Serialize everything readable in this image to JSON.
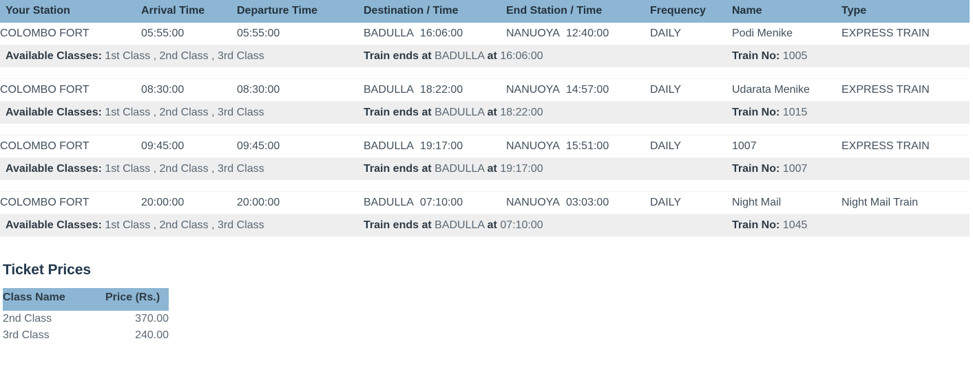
{
  "table": {
    "columns": [
      "Your Station",
      "Arrival Time",
      "Departure Time",
      "Destination / Time",
      "End Station / Time",
      "Frequency",
      "Name",
      "Type"
    ],
    "labels": {
      "available_classes": "Available Classes:",
      "train_ends_at": "Train ends at",
      "at": "at",
      "train_no": "Train No:"
    },
    "rows": [
      {
        "station": "COLOMBO FORT",
        "arrival": "05:55:00",
        "departure": "05:55:00",
        "destination": "BADULLA",
        "destination_time": "16:06:00",
        "end_station": "NANUOYA",
        "end_time": "12:40:00",
        "frequency": "DAILY",
        "name": "Podi Menike",
        "type": "EXPRESS TRAIN",
        "classes": "1st Class ,  2nd Class ,  3rd Class",
        "ends_station": "BADULLA",
        "ends_time": "16:06:00",
        "train_no": "1005"
      },
      {
        "station": "COLOMBO FORT",
        "arrival": "08:30:00",
        "departure": "08:30:00",
        "destination": "BADULLA",
        "destination_time": "18:22:00",
        "end_station": "NANUOYA",
        "end_time": "14:57:00",
        "frequency": "DAILY",
        "name": "Udarata Menike",
        "type": "EXPRESS TRAIN",
        "classes": "1st Class ,  2nd Class ,  3rd Class",
        "ends_station": "BADULLA",
        "ends_time": "18:22:00",
        "train_no": "1015"
      },
      {
        "station": "COLOMBO FORT",
        "arrival": "09:45:00",
        "departure": "09:45:00",
        "destination": "BADULLA",
        "destination_time": "19:17:00",
        "end_station": "NANUOYA",
        "end_time": "15:51:00",
        "frequency": "DAILY",
        "name": "1007",
        "type": "EXPRESS TRAIN",
        "classes": "1st Class ,  2nd Class ,  3rd Class",
        "ends_station": "BADULLA",
        "ends_time": "19:17:00",
        "train_no": "1007"
      },
      {
        "station": "COLOMBO FORT",
        "arrival": "20:00:00",
        "departure": "20:00:00",
        "destination": "BADULLA",
        "destination_time": "07:10:00",
        "end_station": "NANUOYA",
        "end_time": "03:03:00",
        "frequency": "DAILY",
        "name": "Night Mail",
        "type": "Night Mail Train",
        "classes": "1st Class ,  2nd Class ,  3rd Class",
        "ends_station": "BADULLA",
        "ends_time": "07:10:00",
        "train_no": "1045"
      }
    ]
  },
  "prices": {
    "title": "Ticket Prices",
    "columns": [
      "Class Name",
      "Price (Rs.)"
    ],
    "rows": [
      {
        "class_name": "2nd Class",
        "price": "370.00"
      },
      {
        "class_name": "3rd Class",
        "price": "240.00"
      }
    ]
  },
  "colors": {
    "header_bg": "#8cb6d4",
    "arrival_time": "#2f7d32",
    "departure_time": "#c9302c",
    "detail_row_bg": "#eeeeee",
    "title": "#23394d"
  }
}
